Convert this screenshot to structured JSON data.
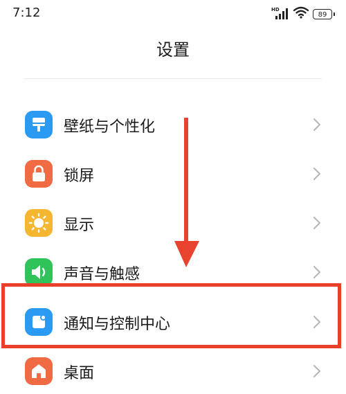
{
  "status_bar": {
    "time": "7:12",
    "network_label": "HD",
    "battery": "89",
    "icons": [
      "signal-icon",
      "wifi-icon",
      "battery-icon"
    ]
  },
  "header": {
    "title": "设置"
  },
  "settings": {
    "items": [
      {
        "label": "壁纸与个性化",
        "icon": "wallpaper-icon",
        "color": "#2b9af3"
      },
      {
        "label": "锁屏",
        "icon": "lock-icon",
        "color": "#f06a43"
      },
      {
        "label": "显示",
        "icon": "sun-icon",
        "color": "#f5b731"
      },
      {
        "label": "声音与触感",
        "icon": "speaker-icon",
        "color": "#2fc35a"
      },
      {
        "label": "通知与控制中心",
        "icon": "notification-icon",
        "color": "#2b9af3"
      },
      {
        "label": "桌面",
        "icon": "home-icon",
        "color": "#f06a43"
      }
    ]
  },
  "annotation": {
    "arrow_color": "#e8432e",
    "highlight_color": "#ea3f2b",
    "highlighted_item": "通知与控制中心"
  }
}
